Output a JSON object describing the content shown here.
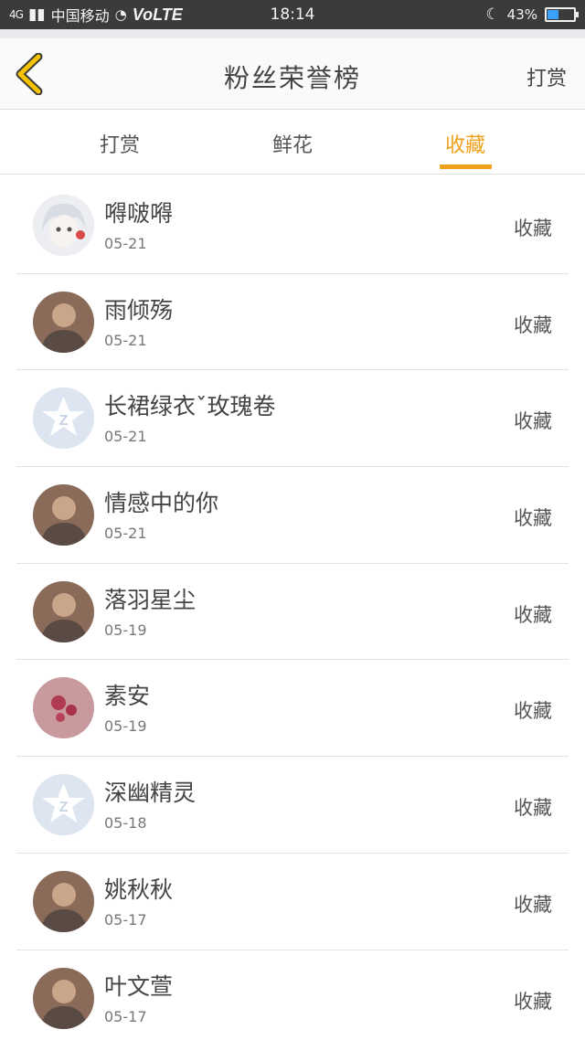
{
  "status_bar": {
    "signal": "4G",
    "carrier": "中国移动",
    "volte": "VoLTE",
    "time": "18:14",
    "battery_percent": "43%",
    "battery_level": 0.43
  },
  "nav": {
    "title": "粉丝荣誉榜",
    "right_action": "打赏"
  },
  "tabs": [
    {
      "label": "打赏",
      "active": false
    },
    {
      "label": "鲜花",
      "active": false
    },
    {
      "label": "收藏",
      "active": true
    }
  ],
  "colors": {
    "accent": "#f0a01a",
    "status_bar_bg": "#3b3b3b",
    "divider": "#e4e4e4"
  },
  "fans": [
    {
      "name": "嘚啵嘚",
      "date": "05-21",
      "action": "收藏",
      "avatar": "anime-girl-avatar"
    },
    {
      "name": "雨倾殇",
      "date": "05-21",
      "action": "收藏",
      "avatar": "photo-avatar"
    },
    {
      "name": "长裙绿衣ˇ玫瑰卷",
      "date": "05-21",
      "action": "收藏",
      "avatar": "default-qq-avatar"
    },
    {
      "name": "情感中的你",
      "date": "05-21",
      "action": "收藏",
      "avatar": "photo-avatar"
    },
    {
      "name": "落羽星尘",
      "date": "05-19",
      "action": "收藏",
      "avatar": "photo-avatar"
    },
    {
      "name": "素安",
      "date": "05-19",
      "action": "收藏",
      "avatar": "flower-avatar"
    },
    {
      "name": "深幽精灵",
      "date": "05-18",
      "action": "收藏",
      "avatar": "default-qq-avatar"
    },
    {
      "name": "姚秋秋",
      "date": "05-17",
      "action": "收藏",
      "avatar": "photo-avatar"
    },
    {
      "name": "叶文萱",
      "date": "05-17",
      "action": "收藏",
      "avatar": "photo-avatar"
    }
  ]
}
